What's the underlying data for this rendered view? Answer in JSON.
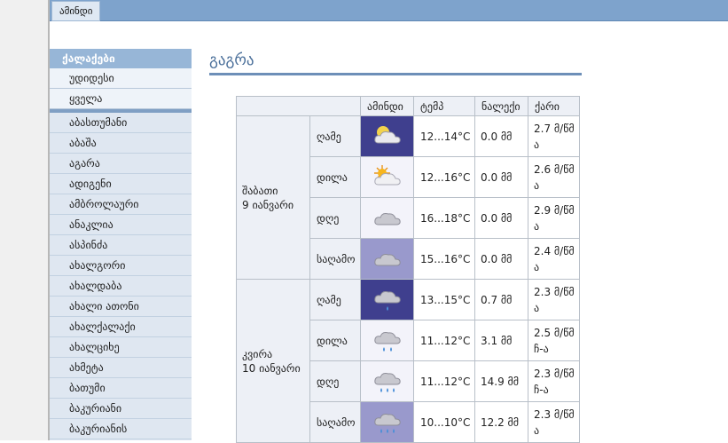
{
  "topbar": {
    "tab_label": "ამინდი"
  },
  "sidebar": {
    "header": "ქალაქები",
    "top_items": [
      "უდიდესი",
      "ყველა"
    ],
    "items": [
      "აბასთუმანი",
      "აბაშა",
      "აგარა",
      "ადიგენი",
      "ამბროლაური",
      "ანაკლია",
      "ასპინძა",
      "ახალგორი",
      "ახალდაბა",
      "ახალი ათონი",
      "ახალქალაქი",
      "ახალციხე",
      "ახმეტა",
      "ბათუმი",
      "ბაკურიანი",
      "ბაკურიანის"
    ]
  },
  "page": {
    "title": "გაგრა"
  },
  "table": {
    "headers": [
      "ამინდი",
      "ტემპ",
      "ნალექი",
      "ქარი"
    ],
    "days": [
      {
        "day": "შაბათი",
        "date": "9 იანვარი",
        "rows": [
          {
            "part": "ღამე",
            "icon": "cloud-moon-icon",
            "bg": "dark",
            "temp": "12...14°C",
            "precip": "0.0 მმ",
            "wind": "2.7 მ/წმ",
            "wind_dir": "ა"
          },
          {
            "part": "დილა",
            "icon": "cloud-sun-icon",
            "bg": "light",
            "temp": "12...16°C",
            "precip": "0.0 მმ",
            "wind": "2.6 მ/წმ",
            "wind_dir": "ა"
          },
          {
            "part": "დღე",
            "icon": "cloud-icon",
            "bg": "light",
            "temp": "16...18°C",
            "precip": "0.0 მმ",
            "wind": "2.9 მ/წმ",
            "wind_dir": "ა"
          },
          {
            "part": "საღამო",
            "icon": "cloud-icon",
            "bg": "mid",
            "temp": "15...16°C",
            "precip": "0.0 მმ",
            "wind": "2.4 მ/წმ",
            "wind_dir": "ა"
          }
        ]
      },
      {
        "day": "კვირა",
        "date": "10 იანვარი",
        "rows": [
          {
            "part": "ღამე",
            "icon": "cloud-rain-light-icon",
            "bg": "dark",
            "temp": "13...15°C",
            "precip": "0.7 მმ",
            "wind": "2.3 მ/წმ",
            "wind_dir": "ა"
          },
          {
            "part": "დილა",
            "icon": "cloud-rain-icon",
            "bg": "light",
            "temp": "11...12°C",
            "precip": "3.1 მმ",
            "wind": "2.5 მ/წმ",
            "wind_dir": "ჩ-ა"
          },
          {
            "part": "დღე",
            "icon": "cloud-heavy-rain-icon",
            "bg": "light",
            "temp": "11...12°C",
            "precip": "14.9 მმ",
            "wind": "2.3 მ/წმ",
            "wind_dir": "ჩ-ა"
          },
          {
            "part": "საღამო",
            "icon": "cloud-heavy-rain-icon",
            "bg": "mid",
            "temp": "10...10°C",
            "precip": "12.2 მმ",
            "wind": "2.3 მ/წმ",
            "wind_dir": "ა"
          }
        ]
      }
    ]
  }
}
